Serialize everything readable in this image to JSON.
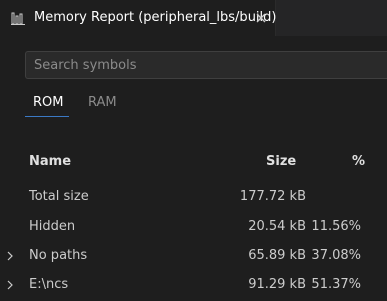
{
  "tab": {
    "title": "Memory Report (peripheral_lbs/build)",
    "icon": "chart-bar-icon",
    "close_icon": "close-icon"
  },
  "search": {
    "placeholder": "Search symbols",
    "value": ""
  },
  "tabs": [
    {
      "label": "ROM",
      "active": true
    },
    {
      "label": "RAM",
      "active": false
    }
  ],
  "table": {
    "headers": {
      "name": "Name",
      "size": "Size",
      "percent": "%"
    },
    "rows": [
      {
        "name": "Total size",
        "size": "177.72 kB",
        "percent": "",
        "expandable": false
      },
      {
        "name": "Hidden",
        "size": "20.54 kB",
        "percent": "11.56%",
        "expandable": false
      },
      {
        "name": "No paths",
        "size": "65.89 kB",
        "percent": "37.08%",
        "expandable": true
      },
      {
        "name": "E:\\ncs",
        "size": "91.29 kB",
        "percent": "51.37%",
        "expandable": true
      }
    ]
  },
  "colors": {
    "background": "#1e1e1e",
    "tabbar": "#252526",
    "accent": "#3b79c5",
    "text": "#cccccc"
  }
}
